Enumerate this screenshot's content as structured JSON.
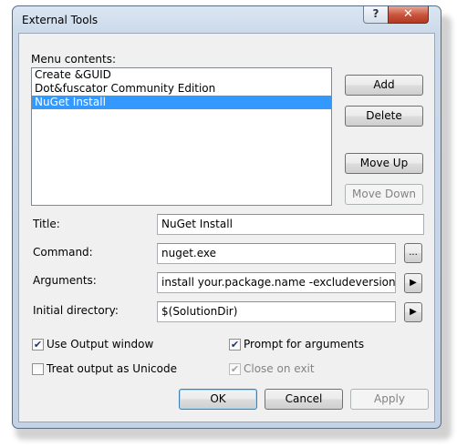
{
  "window": {
    "title": "External Tools",
    "help_label": "?",
    "close_label": "✕"
  },
  "menu": {
    "label": "Menu contents:",
    "items": [
      "Create &GUID",
      "Dot&fuscator Community Edition",
      "NuGet Install"
    ],
    "selected_index": 2
  },
  "buttons": {
    "add": "Add",
    "delete": "Delete",
    "move_up": "Move Up",
    "move_down": "Move Down",
    "ok": "OK",
    "cancel": "Cancel",
    "apply": "Apply"
  },
  "fields": {
    "title_label": "Title:",
    "title_value": "NuGet Install",
    "command_label": "Command:",
    "command_value": "nuget.exe",
    "browse_label": "...",
    "arguments_label": "Arguments:",
    "arguments_value": "install your.package.name -excludeversion -outp",
    "initial_dir_label": "Initial directory:",
    "initial_dir_value": "$(SolutionDir)",
    "arrow_label": "▶"
  },
  "options": {
    "use_output_window": {
      "label": "Use Output window",
      "checked": true
    },
    "prompt_for_arguments": {
      "label": "Prompt for arguments",
      "checked": true
    },
    "treat_output_unicode": {
      "label": "Treat output as Unicode",
      "checked": false
    },
    "close_on_exit": {
      "label": "Close on exit",
      "checked": true,
      "disabled": true
    }
  },
  "colors": {
    "selection": "#3399ff",
    "close_button": "#c8513a"
  }
}
